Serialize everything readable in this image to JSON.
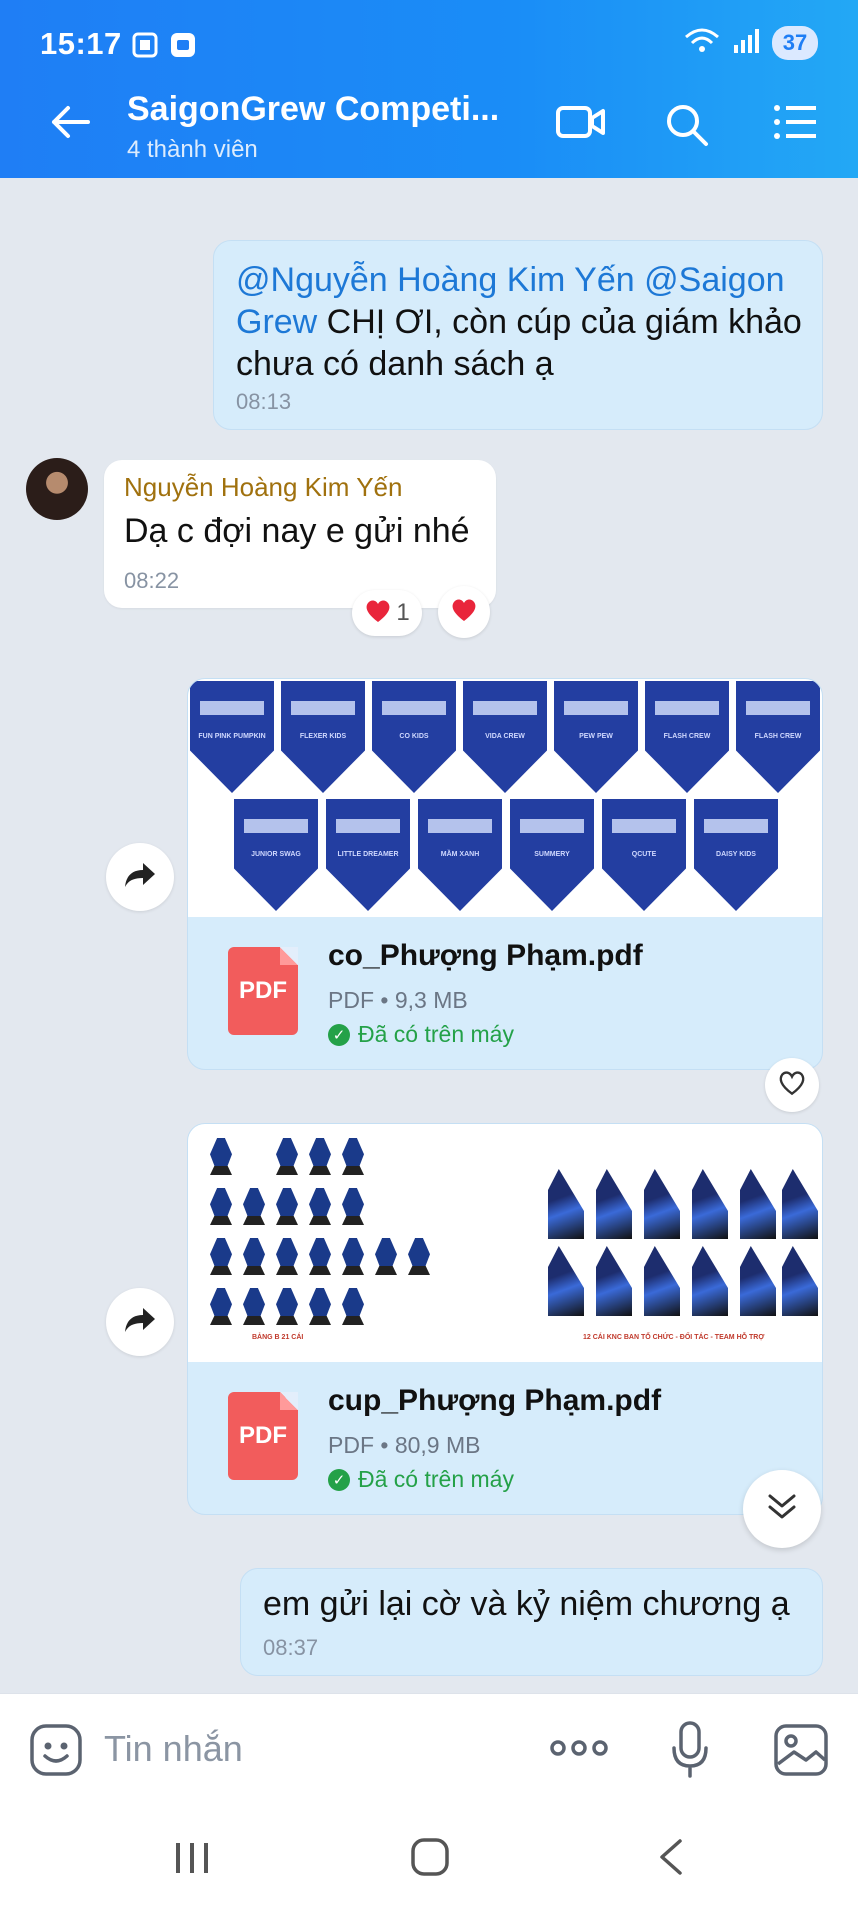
{
  "status_bar": {
    "time": "15:17",
    "battery": "37"
  },
  "header": {
    "title": "SaigonGrew Competi...",
    "subtitle": "4 thành viên"
  },
  "messages": {
    "m1": {
      "mention1": "@Nguyễn Hoàng Kim Yến",
      "mention2": "@Saigon Grew",
      "text": " CHỊ ƠI, còn cúp của giám khảo chưa có danh sách ạ",
      "time": "08:13"
    },
    "m2": {
      "sender": "Nguyễn Hoàng Kim Yến",
      "text": "Dạ c đợi nay e gửi nhé",
      "time": "08:22",
      "reaction_count": "1"
    },
    "m3": {
      "file_name": "co_Phượng Phạm.pdf",
      "file_meta": "PDF • 9,3 MB",
      "file_status": "Đã có trên máy",
      "preview_labels": [
        "FUN PINK PUMPKIN",
        "FLEXER KIDS",
        "CO KIDS",
        "VIDA CREW",
        "PEW PEW",
        "FLASH CREW",
        "FLASH CREW",
        "JUNIOR SWAG",
        "LITTLE DREAMER",
        "MẦM XANH",
        "SUMMERY",
        "QCUTE",
        "DAISY KIDS"
      ]
    },
    "m4": {
      "file_name": "cup_Phượng Phạm.pdf",
      "file_meta": "PDF • 80,9 MB",
      "file_status": "Đã có trên máy",
      "caption_left": "BẢNG B 21 CÁI",
      "caption_right": "12 CÁI KNC BAN TỔ CHỨC - ĐỐI TÁC - TEAM HỖ TRỢ"
    },
    "m5": {
      "text": "em gửi lại cờ và kỷ niệm chương ạ",
      "time": "08:37"
    }
  },
  "input": {
    "placeholder": "Tin nhắn"
  },
  "icons": {
    "back": "arrow-left-icon",
    "video": "video-call-icon",
    "search": "search-icon",
    "menu": "list-menu-icon"
  },
  "colors": {
    "header_start": "#1f7ef5",
    "header_end": "#23a8f5",
    "chat_bg": "#e3e8ef",
    "outgoing_bubble": "#d6ecfb",
    "mention": "#1d78d6",
    "sender": "#a0710e",
    "pdf": "#f25c5c",
    "downloaded": "#24a148"
  }
}
